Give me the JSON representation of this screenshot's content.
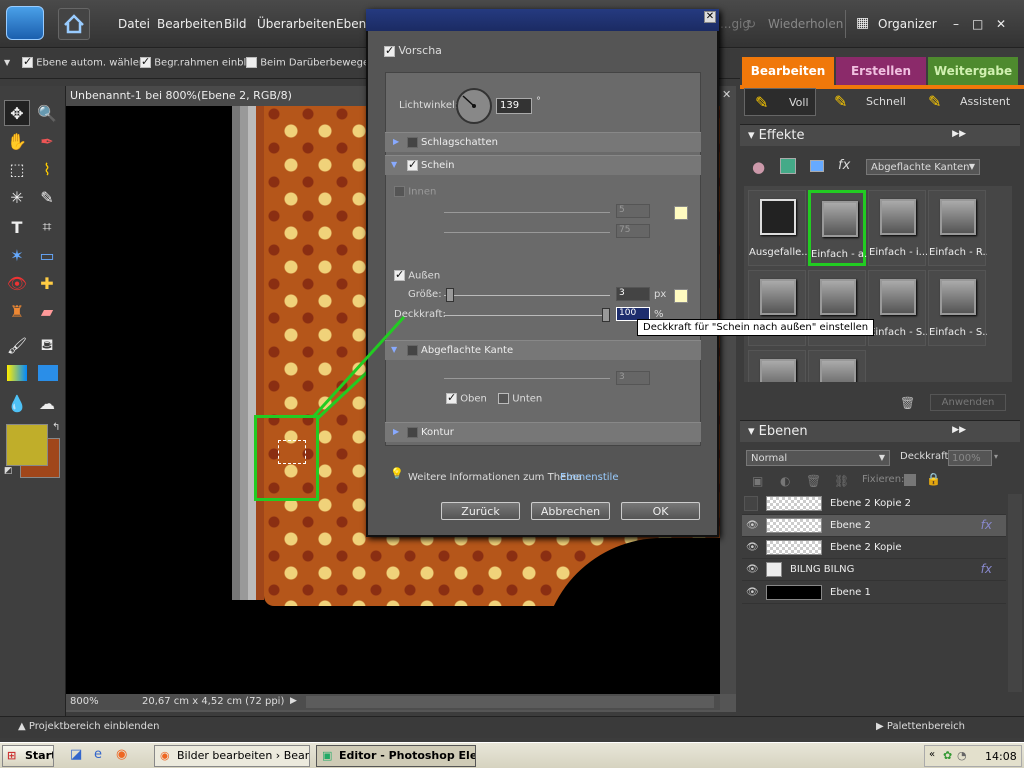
{
  "menu": {
    "items": [
      "Datei",
      "Bearbeiten",
      "Bild",
      "Überarbeiten",
      "Ebene"
    ],
    "undo": "...gig",
    "redo": "Wiederholen",
    "organizer": "Organizer"
  },
  "options": {
    "auto_select": "Ebene autom. wählen",
    "bounding": "Begr.rahmen einbl.",
    "hover": "Beim Darüberbewegen"
  },
  "doc": {
    "title": "Unbenannt-1 bei 800%(Ebene 2, RGB/8)",
    "zoom": "800%",
    "size": "20,67 cm x 4,52 cm (72 ppi)"
  },
  "mode_tabs": {
    "edit": "Bearbeiten",
    "create": "Erstellen",
    "share": "Weitergabe"
  },
  "edit_modes": {
    "full": "Voll",
    "quick": "Schnell",
    "guided": "Assistent"
  },
  "effects": {
    "title": "Effekte",
    "dropdown": "Abgeflachte Kanten",
    "items": [
      "Ausgefalle...",
      "Einfach - a...",
      "Einfach - i...",
      "Einfach - R...",
      "",
      "Einfach - S...",
      "Einfach - S...",
      "Einfach - S..."
    ],
    "apply": "Anwenden"
  },
  "layers": {
    "title": "Ebenen",
    "blend": "Normal",
    "opacity_label": "Deckkraft:",
    "opacity": "100%",
    "lock_label": "Fixieren:",
    "fx": "fx",
    "items": [
      "Ebene 2 Kopie 2",
      "Ebene 2",
      "Ebene 2 Kopie",
      "BILNG BILNG",
      "Ebene 1"
    ]
  },
  "dialog": {
    "preview": "Vorscha",
    "light_angle_label": "Lichtwinkel:",
    "light_angle": "139",
    "deg": "°",
    "sec_shadow": "Schlagschatten",
    "sec_glow": "Schein",
    "inner": "Innen",
    "inner_size": "5",
    "inner_opacity": "75",
    "outer": "Außen",
    "size_label": "Größe:",
    "size": "3",
    "px": "px",
    "opacity_label": "Deckkraft:",
    "opacity": "100",
    "pct": "%",
    "tooltip": "Deckkraft für \"Schein nach außen\" einstellen",
    "sec_bevel": "Abgeflachte Kante",
    "bevel_size": "3",
    "up": "Oben",
    "down": "Unten",
    "sec_stroke": "Kontur",
    "info": "Weitere Informationen zum Thema",
    "info_link": "Ebenenstile",
    "back": "Zurück",
    "cancel": "Abbrechen",
    "ok": "OK"
  },
  "bottom": {
    "project": "Projektbereich einblenden",
    "palettes": "Palettenbereich"
  },
  "taskbar": {
    "start": "Start",
    "task1": "Bilder bearbeiten › Bearb...",
    "task2": "Editor - Photoshop Ele...",
    "time": "14:08"
  },
  "colors": {
    "accent_orange": "#f0780a",
    "create_tab": "#8b2a6a",
    "share_tab": "#4e8a2e",
    "highlight_green": "#22cc22",
    "fg_swatch": "#c0ae2a"
  }
}
